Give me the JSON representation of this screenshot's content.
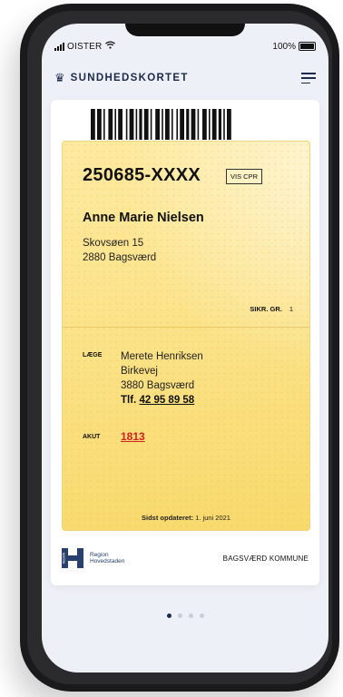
{
  "status": {
    "carrier": "OISTER",
    "battery": "100%"
  },
  "header": {
    "brand": "SUNDHEDSKORTET"
  },
  "card": {
    "cpr": "250685-XXXX",
    "vis_cpr": "VIS CPR",
    "name": "Anne Marie Nielsen",
    "address_line1": "Skovsøen 15",
    "address_line2": "2880 Bagsværd",
    "sikr_label": "SIKR. GR.",
    "sikr_value": "1",
    "laege_label": "LÆGE",
    "doctor_name": "Merete Henriksen",
    "doctor_street": "Birkevej",
    "doctor_city": "3880 Bagsværd",
    "tlf_label": "Tlf.",
    "tlf_number": "42 95 89 58",
    "akut_label": "AKUT",
    "akut_number": "1813",
    "updated_label": "Sidst opdateret:",
    "updated_date": "1. juni 2021"
  },
  "footer": {
    "region_line1": "Region",
    "region_line2": "Hovedstaden",
    "region_mark_text": "REGION",
    "kommune": "BAGSVÆRD KOMMUNE"
  },
  "pager": {
    "pages": 4,
    "active": 0
  },
  "colors": {
    "card_yellow": "#fbe38a",
    "akut_red": "#d42020",
    "brand_navy": "#1b2a4a"
  }
}
